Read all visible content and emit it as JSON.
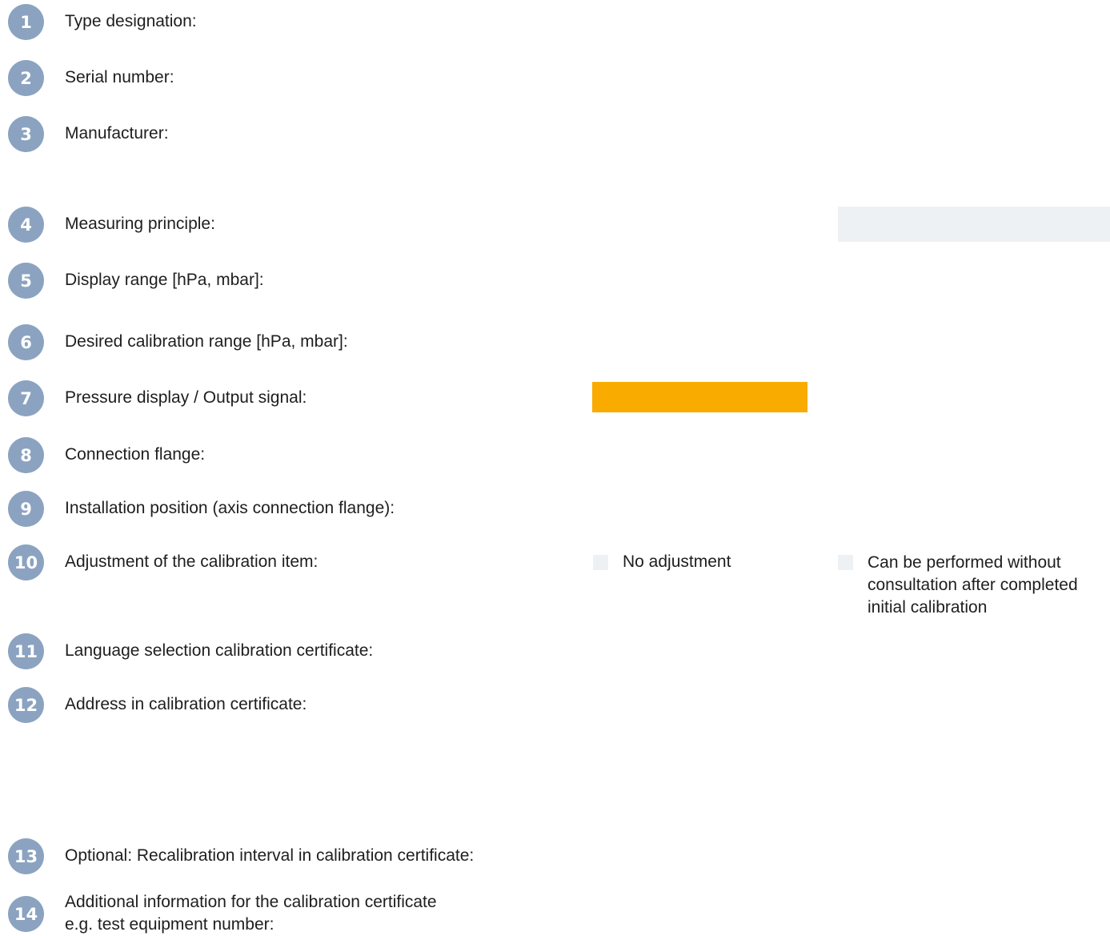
{
  "items": [
    {
      "number": "1",
      "label": "Type designation:"
    },
    {
      "number": "2",
      "label": "Serial number:"
    },
    {
      "number": "3",
      "label": "Manufacturer:"
    },
    {
      "number": "4",
      "label": "Measuring principle:"
    },
    {
      "number": "5",
      "label": "Display range [hPa, mbar]:"
    },
    {
      "number": "6",
      "label": "Desired calibration range [hPa, mbar]:"
    },
    {
      "number": "7",
      "label": "Pressure display / Output signal:"
    },
    {
      "number": "8",
      "label": "Connection flange:"
    },
    {
      "number": "9",
      "label": "Installation position (axis connection flange):"
    },
    {
      "number": "10",
      "label": "Adjustment of the calibration item:"
    },
    {
      "number": "11",
      "label": "Language selection calibration certificate:"
    },
    {
      "number": "12",
      "label": "Address in calibration certificate:"
    },
    {
      "number": "13",
      "label": "Optional: Recalibration interval in calibration certificate:"
    },
    {
      "number": "14",
      "label_line1": "Additional information for the calibration certificate",
      "label_line2": "e.g. test equipment number:"
    }
  ],
  "adjustment_options": {
    "no_adjustment": "No adjustment",
    "without_consultation_line1": "Can be performed without",
    "without_consultation_line2": "consultation after completed",
    "without_consultation_line3": "initial calibration"
  },
  "colors": {
    "badge": "#8ba3c0",
    "field_grey": "#eef1f3",
    "field_orange": "#f9ab00"
  }
}
